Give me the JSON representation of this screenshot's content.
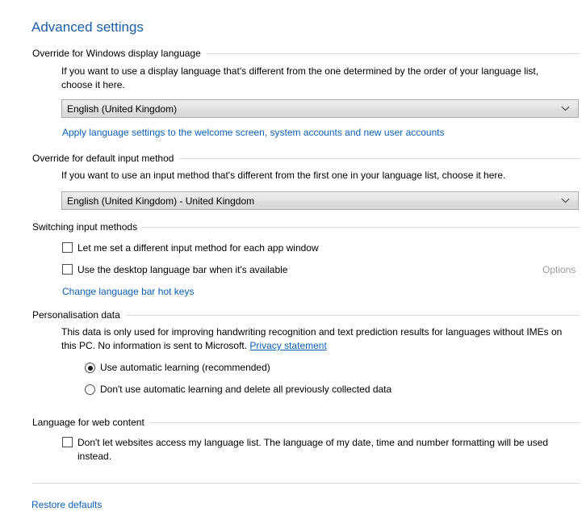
{
  "page": {
    "title": "Advanced settings"
  },
  "sections": {
    "display_language": {
      "header": "Override for Windows display language",
      "description": "If you want to use a display language that's different from the one determined by the order of your language list, choose it here.",
      "dropdown_value": "English (United Kingdom)",
      "link": "Apply language settings to the welcome screen, system accounts and new user accounts"
    },
    "input_method": {
      "header": "Override for default input method",
      "description": "If you want to use an input method that's different from the first one in your language list, choose it here.",
      "dropdown_value": "English (United Kingdom) - United Kingdom"
    },
    "switching": {
      "header": "Switching input methods",
      "checkbox_app_window": "Let me set a different input method for each app window",
      "checkbox_language_bar": "Use the desktop language bar when it's available",
      "options_link": "Options",
      "hotkeys_link": "Change language bar hot keys"
    },
    "personalisation": {
      "header": "Personalisation data",
      "description_before_link": "This data is only used for improving handwriting recognition and text prediction results for languages without IMEs on this PC. No information is sent to Microsoft. ",
      "privacy_link": "Privacy statement",
      "radio_auto_learning": "Use automatic learning (recommended)",
      "radio_no_learning": "Don't use automatic learning and delete all previously collected data"
    },
    "web_content": {
      "header": "Language for web content",
      "checkbox_no_access": "Don't let websites access my language list. The language of my date, time and number formatting will be used instead."
    }
  },
  "footer": {
    "restore_defaults": "Restore defaults"
  },
  "icons": {
    "chevron_down": "chevron-down-icon"
  },
  "colors": {
    "title_blue": "#1b5ea8",
    "link_blue": "#0b5fb5",
    "disabled_gray": "#9a9a9a",
    "rule_gray": "#d9d9d9",
    "combo_border": "#acacac"
  }
}
